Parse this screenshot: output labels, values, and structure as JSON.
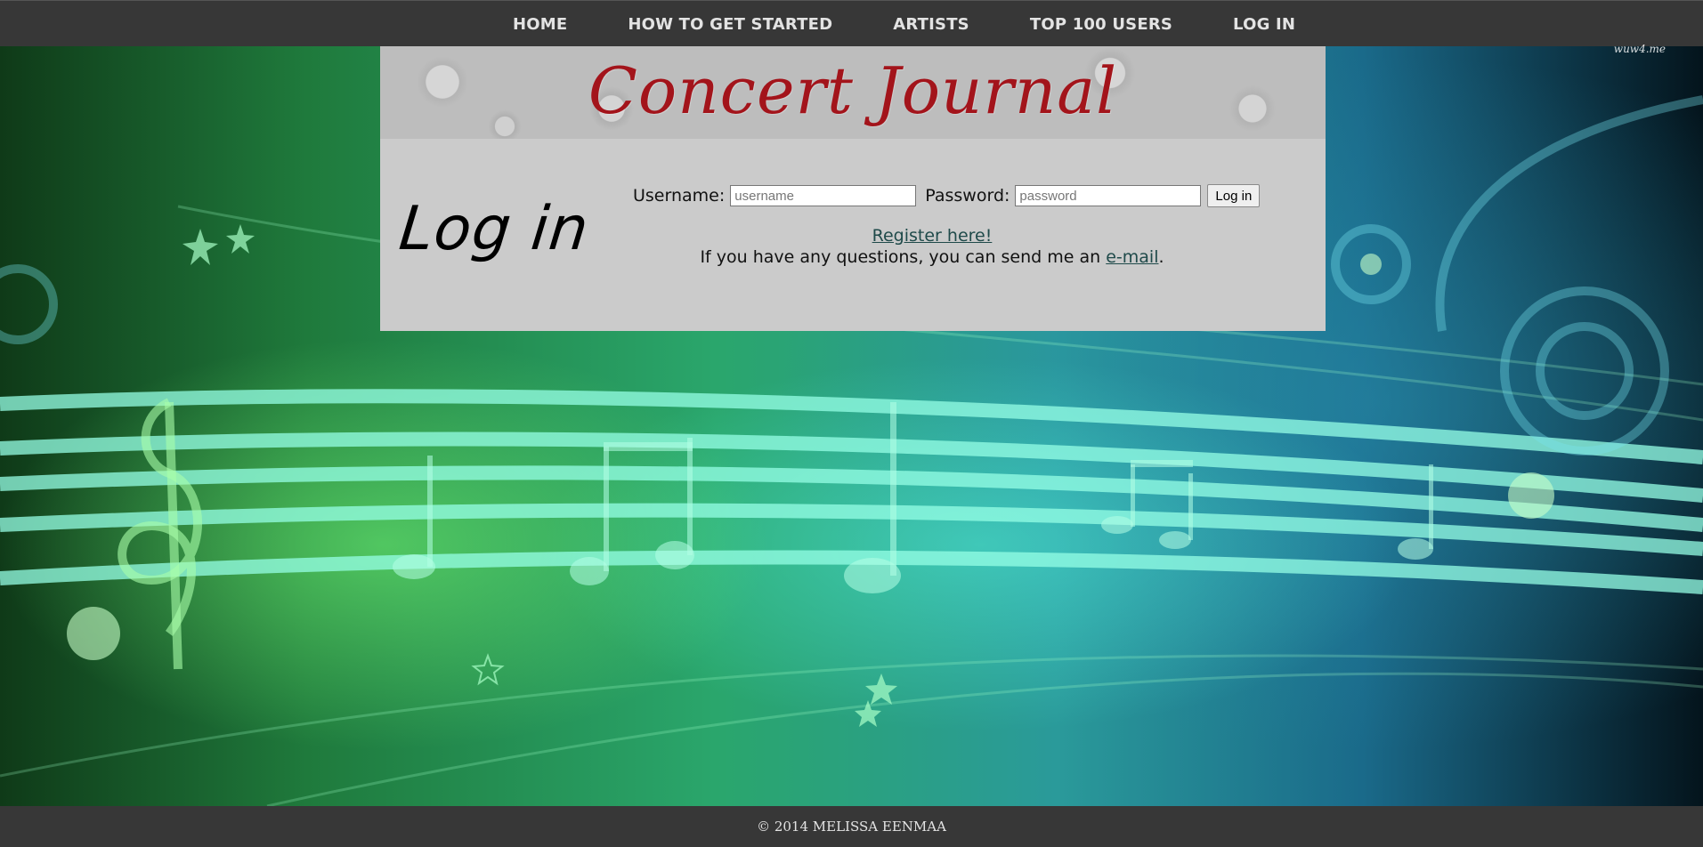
{
  "nav": {
    "items": [
      {
        "label": "HOME"
      },
      {
        "label": "HOW TO GET STARTED"
      },
      {
        "label": "ARTISTS"
      },
      {
        "label": "TOP 100 USERS"
      },
      {
        "label": "LOG IN"
      }
    ]
  },
  "watermark": "wuw4.me",
  "banner": {
    "title": "Concert Journal"
  },
  "main": {
    "heading": "Log in",
    "form": {
      "username_label": "Username:",
      "username_placeholder": "username",
      "password_label": "Password:",
      "password_placeholder": "password",
      "submit_label": "Log in"
    },
    "register_link": "Register here!",
    "questions_text": "If you have any questions, you can send me an ",
    "email_link": "e-mail",
    "questions_end": "."
  },
  "footer": {
    "text": "© 2014 MELISSA EENMAA"
  }
}
